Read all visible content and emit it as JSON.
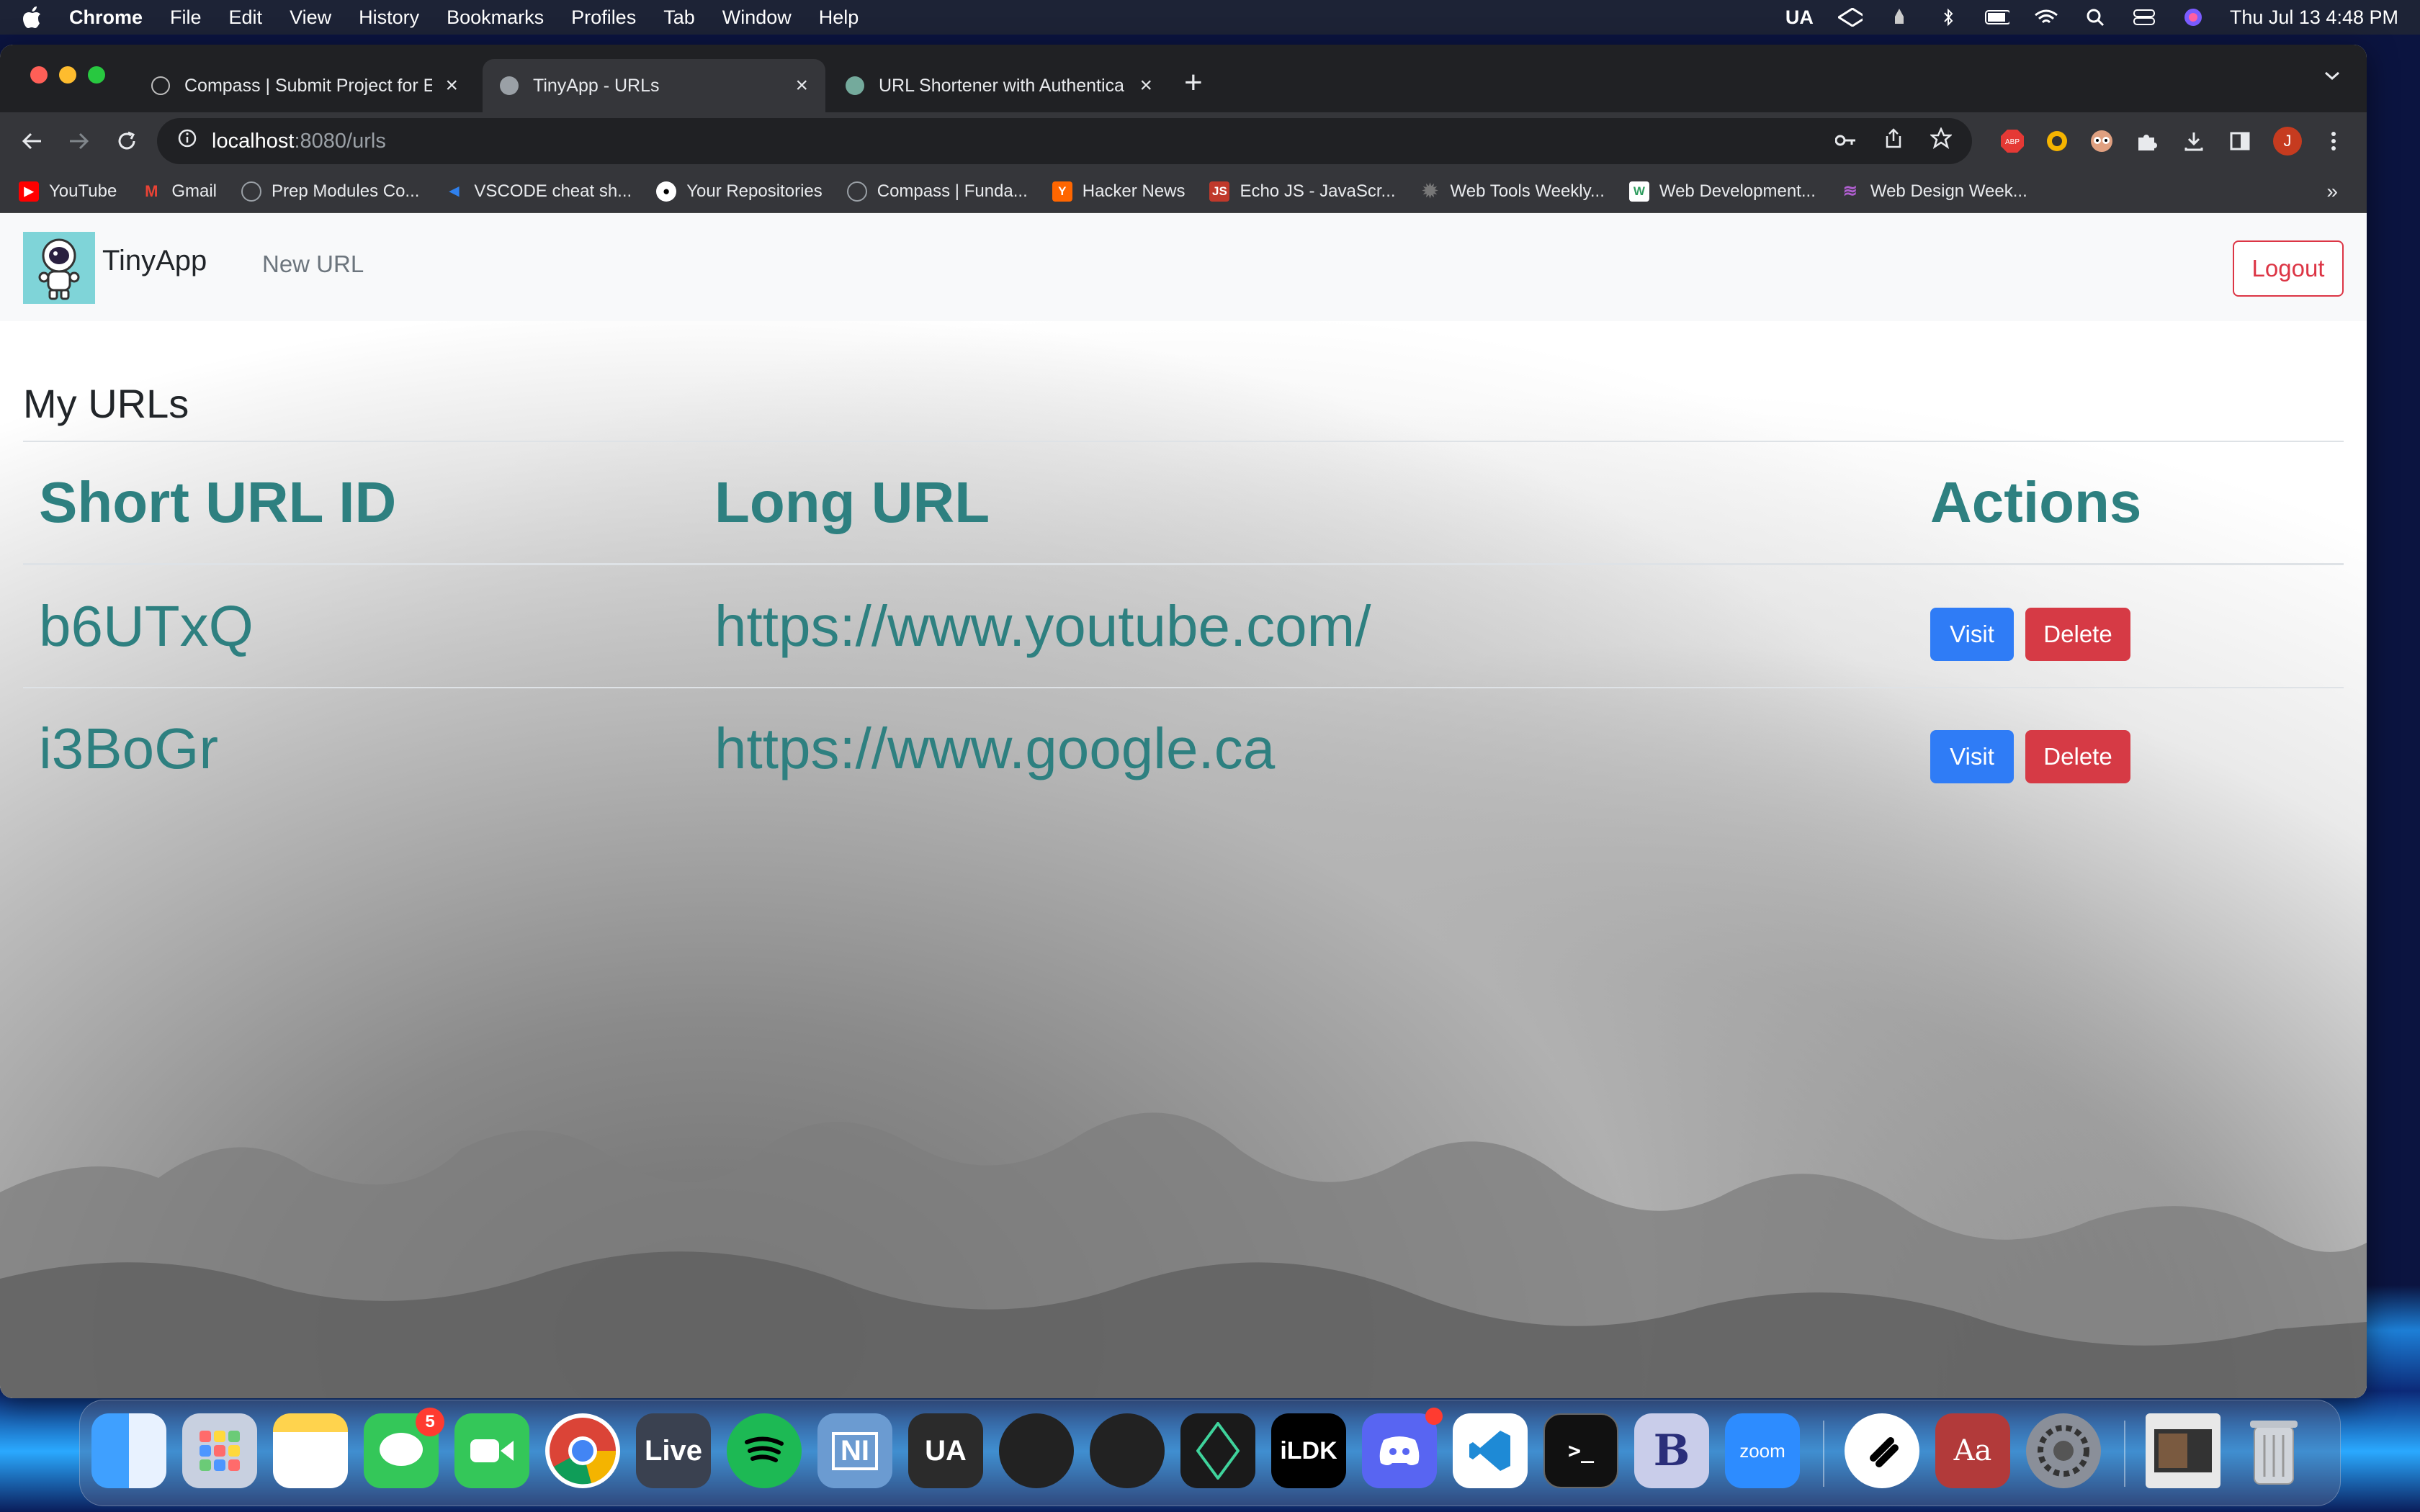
{
  "menubar": {
    "app_name": "Chrome",
    "items": [
      "File",
      "Edit",
      "View",
      "History",
      "Bookmarks",
      "Profiles",
      "Tab",
      "Window",
      "Help"
    ],
    "status_ua": "UA",
    "clock": "Thu Jul 13  4:48 PM"
  },
  "tabs": [
    {
      "title": "Compass | Submit Project for E",
      "icon": "compass-icon"
    },
    {
      "title": "TinyApp - URLs",
      "icon": "globe-icon"
    },
    {
      "title": "URL Shortener with Authentica",
      "icon": "chatgpt-icon"
    }
  ],
  "address": {
    "host": "localhost",
    "path": ":8080/urls"
  },
  "bookmarks": [
    {
      "label": "YouTube",
      "icon": "youtube-icon",
      "color": "#ff0000"
    },
    {
      "label": "Gmail",
      "icon": "gmail-icon",
      "color": "#ea4335"
    },
    {
      "label": "Prep Modules Co...",
      "icon": "compass-icon",
      "color": "#9aa0a6"
    },
    {
      "label": "VSCODE cheat sh...",
      "icon": "vscode-icon",
      "color": "#2f80ed"
    },
    {
      "label": "Your Repositories",
      "icon": "github-icon",
      "color": "#ffffff"
    },
    {
      "label": "Compass | Funda...",
      "icon": "compass-icon",
      "color": "#9aa0a6"
    },
    {
      "label": "Hacker News",
      "icon": "hackernews-icon",
      "color": "#ff6600"
    },
    {
      "label": "Echo JS - JavaScr...",
      "icon": "echojs-icon",
      "color": "#c0392b"
    },
    {
      "label": "Web Tools Weekly...",
      "icon": "gear-icon",
      "color": "#555555"
    },
    {
      "label": "Web Development...",
      "icon": "w-icon",
      "color": "#ffffff"
    },
    {
      "label": "Web Design Week...",
      "icon": "waves-icon",
      "color": "#8e44ad"
    }
  ],
  "app": {
    "brand": "TinyApp",
    "nav_new_url": "New URL",
    "logout": "Logout",
    "heading": "My URLs",
    "columns": [
      "Short URL ID",
      "Long URL",
      "Actions"
    ],
    "rows": [
      {
        "id": "b6UTxQ",
        "long_url": "https://www.youtube.com/",
        "visit": "Visit",
        "delete": "Delete"
      },
      {
        "id": "i3BoGr",
        "long_url": "https://www.google.ca",
        "visit": "Visit",
        "delete": "Delete"
      }
    ]
  },
  "dock": {
    "messages_badge": "5",
    "apps": [
      "Finder",
      "Launchpad",
      "Notes",
      "Messages",
      "FaceTime",
      "Chrome",
      "Live",
      "Spotify",
      "Native Instruments",
      "UA Connect",
      "UA Console",
      "UA Meter",
      "Arturia",
      "iLok",
      "Discord",
      "VS Code",
      "Terminal",
      "BBEdit",
      "Zoom",
      "Scrivener",
      "Dictionary",
      "System Settings",
      "Document",
      "Trash"
    ],
    "live_label": "Live",
    "ua_label": "UA",
    "zoom_label": "zoom",
    "ilok_label": "iLDK",
    "dict_label": "Aa"
  },
  "colors": {
    "teal": "#2e8080",
    "visit": "#2f7cf6",
    "delete": "#d63a45"
  }
}
